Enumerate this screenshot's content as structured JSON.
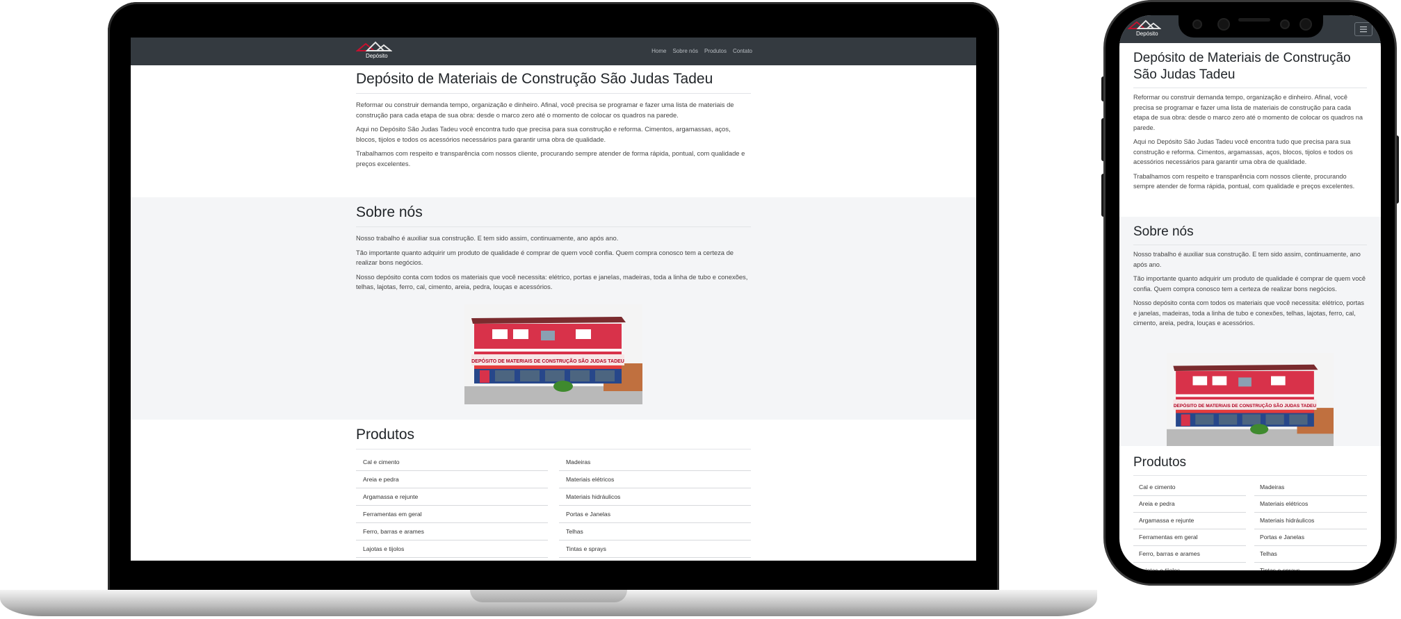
{
  "brand": {
    "logo_text": "Depósito"
  },
  "nav": {
    "links": [
      "Home",
      "Sobre nós",
      "Produtos",
      "Contato"
    ]
  },
  "intro": {
    "title": "Depósito de Materiais de Construção São Judas Tadeu",
    "paragraphs": [
      "Reformar ou construir demanda tempo, organização e dinheiro. Afinal, você precisa se programar e fazer uma lista de materiais de construção para cada etapa de sua obra: desde o marco zero até o momento de colocar os quadros na parede.",
      "Aqui no Depósito São Judas Tadeu você encontra tudo que precisa para sua construção e reforma. Cimentos, argamassas, aços, blocos, tijolos e todos os acessórios necessários para garantir uma obra de qualidade.",
      "Trabalhamos com respeito e transparência com nossos cliente, procurando sempre atender de forma rápida, pontual, com qualidade e preços excelentes."
    ]
  },
  "about": {
    "title": "Sobre nós",
    "paragraphs": [
      "Nosso trabalho é auxiliar sua construção. E tem sido assim, continuamente, ano após ano.",
      "Tão importante quanto adquirir um produto de qualidade é comprar de quem você confia. Quem compra conosco tem a certeza de realizar bons negócios.",
      "Nosso depósito conta com todos os materiais que você necessita: elétrico, portas e janelas, madeiras, toda a linha de tubo e conexões, telhas, lajotas, ferro, cal, cimento, areia, pedra, louças e acessórios."
    ],
    "storefront_sign": "DEPÓSITO DE MATERIAIS DE CONSTRUÇÃO SÃO JUDAS TADEU"
  },
  "products": {
    "title": "Produtos",
    "left": [
      "Cal e cimento",
      "Areia e pedra",
      "Argamassa e rejunte",
      "Ferramentas em geral",
      "Ferro, barras e arames",
      "Lajotas e tijolos"
    ],
    "right": [
      "Madeiras",
      "Materiais elétricos",
      "Materiais hidráulicos",
      "Portas e Janelas",
      "Telhas",
      "Tintas e sprays"
    ]
  },
  "phone_ui": {
    "menu_icon": "hamburger-icon"
  },
  "colors": {
    "navbar": "#343a40",
    "section_alt": "#f4f5f7",
    "building_red": "#d8324a",
    "building_blue": "#27478a"
  }
}
